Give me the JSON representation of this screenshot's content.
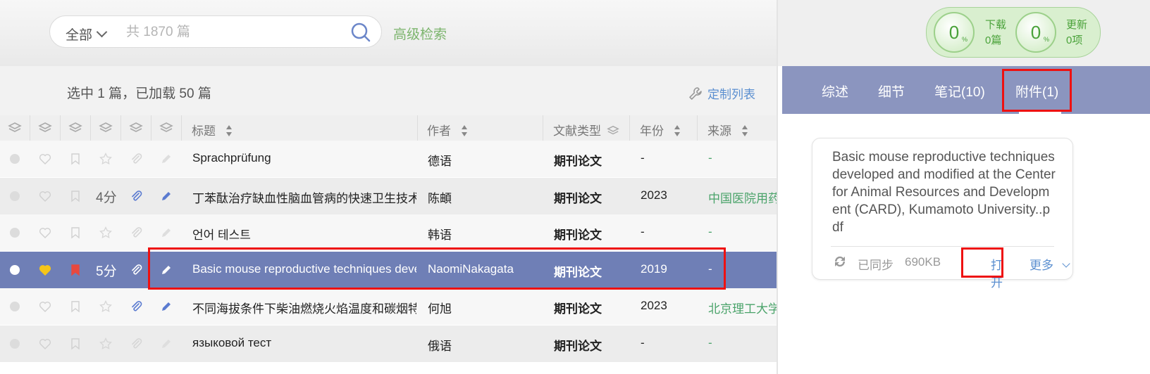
{
  "search": {
    "scope": "全部",
    "placeholder": "共 1870 篇",
    "advanced_label": "高级检索"
  },
  "toolbar": {
    "selection_info": "选中 1 篇，已加载 50 篇",
    "customize_label": "定制列表"
  },
  "columns": {
    "title": "标题",
    "author": "作者",
    "type": "文献类型",
    "year": "年份",
    "source": "来源"
  },
  "rows": [
    {
      "title": "Sprachprüfung",
      "author": "德语",
      "type": "期刊论文",
      "year": "-",
      "source": "-",
      "rating": "",
      "favorite": false,
      "bookmarked": false,
      "attachment": false,
      "note": false,
      "selected": false
    },
    {
      "title": "丁苯酞治疗缺血性脑血管病的快速卫生技术评估",
      "author": "陈頔",
      "type": "期刊论文",
      "year": "2023",
      "source": "中国医院用药",
      "rating": "4分",
      "favorite": false,
      "bookmarked": false,
      "attachment": true,
      "note": true,
      "selected": false
    },
    {
      "title": "언어 테스트",
      "author": "韩语",
      "type": "期刊论文",
      "year": "-",
      "source": "-",
      "rating": "",
      "favorite": false,
      "bookmarked": false,
      "attachment": false,
      "note": false,
      "selected": false
    },
    {
      "title": "Basic mouse reproductive techniques developed",
      "author": "NaomiNakagata",
      "type": "期刊论文",
      "year": "2019",
      "source": "-",
      "rating": "5分",
      "favorite": true,
      "bookmarked": true,
      "attachment": true,
      "note": true,
      "selected": true
    },
    {
      "title": "不同海拔条件下柴油燃烧火焰温度和碳烟特性",
      "author": "何旭",
      "type": "期刊论文",
      "year": "2023",
      "source": "北京理工大学",
      "rating": "",
      "favorite": false,
      "bookmarked": false,
      "attachment": true,
      "note": true,
      "selected": false
    },
    {
      "title": "языковой тест",
      "author": "俄语",
      "type": "期刊论文",
      "year": "-",
      "source": "-",
      "rating": "",
      "favorite": false,
      "bookmarked": false,
      "attachment": false,
      "note": false,
      "selected": false
    }
  ],
  "stats": {
    "download": {
      "value": "0",
      "unit": "%",
      "label": "下载",
      "sub": "0篇"
    },
    "update": {
      "value": "0",
      "unit": "%",
      "label": "更新",
      "sub": "0项"
    }
  },
  "tabs": [
    {
      "label": "综述"
    },
    {
      "label": "细节"
    },
    {
      "label": "笔记(10)"
    },
    {
      "label": "附件(1)",
      "active": true
    }
  ],
  "attachment": {
    "name": "Basic mouse reproductive techniques developed and modified at the Center for Animal Resources and Development (CARD), Kumamoto University..pdf",
    "status": "已同步",
    "size": "690KB",
    "open_label": "打开",
    "more_label": "更多"
  },
  "colors": {
    "accent": "#8b95bf",
    "selected_row": "#6f7fb6",
    "green": "#7cb56d",
    "link": "#5b8fd0",
    "highlight_box": "#e11111"
  }
}
